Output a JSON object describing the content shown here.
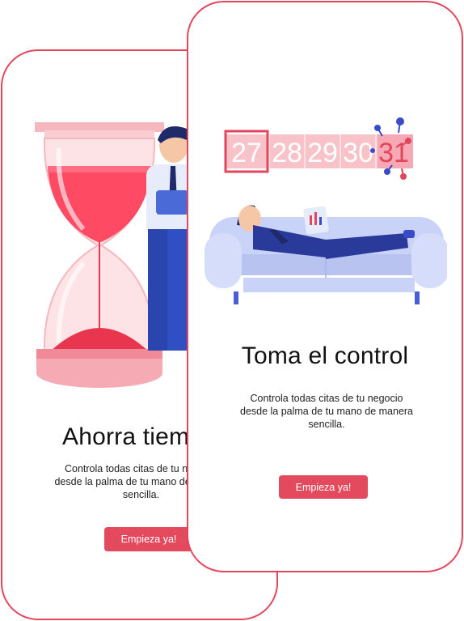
{
  "colors": {
    "accent": "#e3455c",
    "button": "#e44a5e"
  },
  "back_card": {
    "title": "Ahorra tiempo",
    "description_lines": [
      "Controla todas citas de tu negocio",
      "desde la palma de tu mano de manera",
      "sencilla."
    ],
    "button_label": "Empieza ya!",
    "illustration": "hourglass-businessman"
  },
  "front_card": {
    "title": "Toma el control",
    "description_lines": [
      "Controla todas citas de tu negocio",
      "desde la palma de tu mano de manera",
      "sencilla."
    ],
    "button_label": "Empieza ya!",
    "illustration": "man-on-sofa-calendar",
    "calendar_days": [
      "27",
      "28",
      "29",
      "30",
      "31"
    ]
  }
}
